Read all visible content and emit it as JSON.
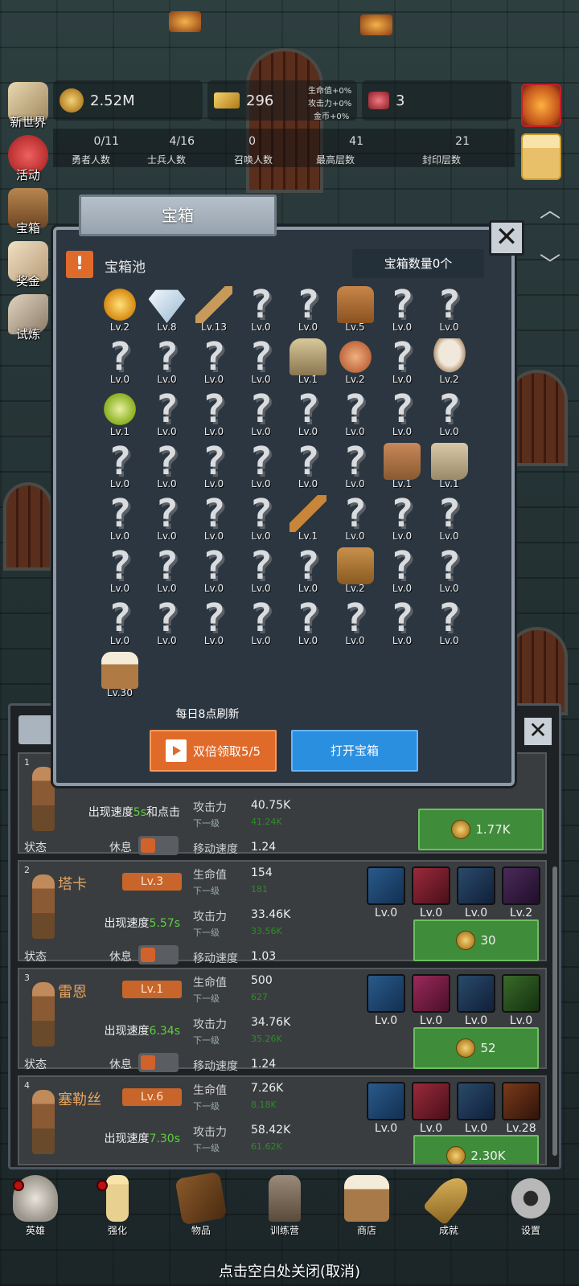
{
  "resources": {
    "gold": "2.52M",
    "bars": "296",
    "gems": "3",
    "bonus_hp": "生命值+0%",
    "bonus_atk": "攻击力+0%",
    "bonus_gold": "金币+0%"
  },
  "population": [
    {
      "value": "0/11",
      "label": "勇者人数"
    },
    {
      "value": "4/16",
      "label": "士兵人数"
    },
    {
      "value": "0",
      "label": "召唤人数"
    },
    {
      "value": "41",
      "label": "最高层数"
    },
    {
      "value": "21",
      "label": "封印层数"
    }
  ],
  "side_menu": [
    "新世界",
    "活动",
    "宝箱",
    "奖金",
    "试炼"
  ],
  "modal": {
    "title": "宝箱",
    "pool_label": "宝箱池",
    "chest_count": "宝箱数量0个",
    "refresh_note": "每日8点刷新",
    "double_btn": "双倍领取5/5",
    "open_btn": "打开宝箱",
    "alert_icon": "!",
    "close_icon": "✕",
    "items": [
      {
        "icon": "crown",
        "lv": "Lv.2"
      },
      {
        "icon": "diamond",
        "lv": "Lv.8"
      },
      {
        "icon": "sword",
        "lv": "Lv.13"
      },
      {
        "icon": "unknown",
        "lv": "Lv.0"
      },
      {
        "icon": "unknown",
        "lv": "Lv.0"
      },
      {
        "icon": "armor",
        "lv": "Lv.5"
      },
      {
        "icon": "unknown",
        "lv": "Lv.0"
      },
      {
        "icon": "unknown",
        "lv": "Lv.0"
      },
      {
        "icon": "unknown",
        "lv": "Lv.0"
      },
      {
        "icon": "unknown",
        "lv": "Lv.0"
      },
      {
        "icon": "unknown",
        "lv": "Lv.0"
      },
      {
        "icon": "unknown",
        "lv": "Lv.0"
      },
      {
        "icon": "helmet",
        "lv": "Lv.1"
      },
      {
        "icon": "meat",
        "lv": "Lv.2"
      },
      {
        "icon": "unknown",
        "lv": "Lv.0"
      },
      {
        "icon": "bowl",
        "lv": "Lv.2"
      },
      {
        "icon": "potion",
        "lv": "Lv.1"
      },
      {
        "icon": "unknown",
        "lv": "Lv.0"
      },
      {
        "icon": "unknown",
        "lv": "Lv.0"
      },
      {
        "icon": "unknown",
        "lv": "Lv.0"
      },
      {
        "icon": "unknown",
        "lv": "Lv.0"
      },
      {
        "icon": "unknown",
        "lv": "Lv.0"
      },
      {
        "icon": "unknown",
        "lv": "Lv.0"
      },
      {
        "icon": "unknown",
        "lv": "Lv.0"
      },
      {
        "icon": "unknown",
        "lv": "Lv.0"
      },
      {
        "icon": "unknown",
        "lv": "Lv.0"
      },
      {
        "icon": "unknown",
        "lv": "Lv.0"
      },
      {
        "icon": "unknown",
        "lv": "Lv.0"
      },
      {
        "icon": "unknown",
        "lv": "Lv.0"
      },
      {
        "icon": "unknown",
        "lv": "Lv.0"
      },
      {
        "icon": "boot",
        "lv": "Lv.1"
      },
      {
        "icon": "boot2",
        "lv": "Lv.1"
      },
      {
        "icon": "unknown",
        "lv": "Lv.0"
      },
      {
        "icon": "unknown",
        "lv": "Lv.0"
      },
      {
        "icon": "unknown",
        "lv": "Lv.0"
      },
      {
        "icon": "unknown",
        "lv": "Lv.0"
      },
      {
        "icon": "torch",
        "lv": "Lv.1"
      },
      {
        "icon": "unknown",
        "lv": "Lv.0"
      },
      {
        "icon": "unknown",
        "lv": "Lv.0"
      },
      {
        "icon": "unknown",
        "lv": "Lv.0"
      },
      {
        "icon": "unknown",
        "lv": "Lv.0"
      },
      {
        "icon": "unknown",
        "lv": "Lv.0"
      },
      {
        "icon": "unknown",
        "lv": "Lv.0"
      },
      {
        "icon": "unknown",
        "lv": "Lv.0"
      },
      {
        "icon": "unknown",
        "lv": "Lv.0"
      },
      {
        "icon": "backpack",
        "lv": "Lv.2"
      },
      {
        "icon": "unknown",
        "lv": "Lv.0"
      },
      {
        "icon": "unknown",
        "lv": "Lv.0"
      },
      {
        "icon": "unknown",
        "lv": "Lv.0"
      },
      {
        "icon": "unknown",
        "lv": "Lv.0"
      },
      {
        "icon": "unknown",
        "lv": "Lv.0"
      },
      {
        "icon": "unknown",
        "lv": "Lv.0"
      },
      {
        "icon": "unknown",
        "lv": "Lv.0"
      },
      {
        "icon": "unknown",
        "lv": "Lv.0"
      },
      {
        "icon": "unknown",
        "lv": "Lv.0"
      },
      {
        "icon": "unknown",
        "lv": "Lv.0"
      },
      {
        "icon": "beer",
        "lv": "Lv.30"
      }
    ]
  },
  "heroes": [
    {
      "num": "1",
      "name": "",
      "lv": "",
      "speed_prefix": "出现速度",
      "speed": "5s",
      "speed_suffix": "和点击",
      "hp_label": "",
      "hp": "",
      "hp_next_label": "",
      "hp_next": "",
      "atk_label": "攻击力",
      "atk": "40.75K",
      "atk_next_label": "下一级",
      "atk_next": "41.24K",
      "move_label": "移动速度",
      "move": "1.24",
      "state": "状态",
      "rest": "休息",
      "cost": "1.77K",
      "skills": []
    },
    {
      "num": "2",
      "name": "塔卡",
      "lv": "Lv.3",
      "speed_prefix": "出现速度",
      "speed": "5.57s",
      "speed_suffix": "",
      "hp_label": "生命值",
      "hp": "154",
      "hp_next_label": "下一级",
      "hp_next": "181",
      "atk_label": "攻击力",
      "atk": "33.46K",
      "atk_next_label": "下一级",
      "atk_next": "33.56K",
      "move_label": "移动速度",
      "move": "1.03",
      "state": "状态",
      "rest": "休息",
      "cost": "30",
      "skills": [
        "Lv.0",
        "Lv.0",
        "Lv.0",
        "Lv.2"
      ]
    },
    {
      "num": "3",
      "name": "雷恩",
      "lv": "Lv.1",
      "speed_prefix": "出现速度",
      "speed": "6.34s",
      "speed_suffix": "",
      "hp_label": "生命值",
      "hp": "500",
      "hp_next_label": "下一级",
      "hp_next": "627",
      "atk_label": "攻击力",
      "atk": "34.76K",
      "atk_next_label": "下一级",
      "atk_next": "35.26K",
      "move_label": "移动速度",
      "move": "1.24",
      "state": "状态",
      "rest": "休息",
      "cost": "52",
      "skills": [
        "Lv.0",
        "Lv.0",
        "Lv.0",
        "Lv.0"
      ]
    },
    {
      "num": "4",
      "name": "塞勒丝",
      "lv": "Lv.6",
      "speed_prefix": "出现速度",
      "speed": "7.30s",
      "speed_suffix": "",
      "hp_label": "生命值",
      "hp": "7.26K",
      "hp_next_label": "下一级",
      "hp_next": "8.18K",
      "atk_label": "攻击力",
      "atk": "58.42K",
      "atk_next_label": "下一级",
      "atk_next": "61.62K",
      "move_label": "",
      "move": "",
      "state": "",
      "rest": "",
      "cost": "2.30K",
      "skills": [
        "Lv.0",
        "Lv.0",
        "Lv.0",
        "Lv.28"
      ]
    }
  ],
  "nav": [
    "英雄",
    "强化",
    "物品",
    "训练营",
    "商店",
    "成就",
    "设置"
  ],
  "close_hint": "点击空白处关闭(取消)",
  "colors": {
    "accent_orange": "#e06a2a",
    "accent_blue": "#2b8fe0",
    "green": "#3f8c3a",
    "speed_green": "#5bd03c"
  }
}
